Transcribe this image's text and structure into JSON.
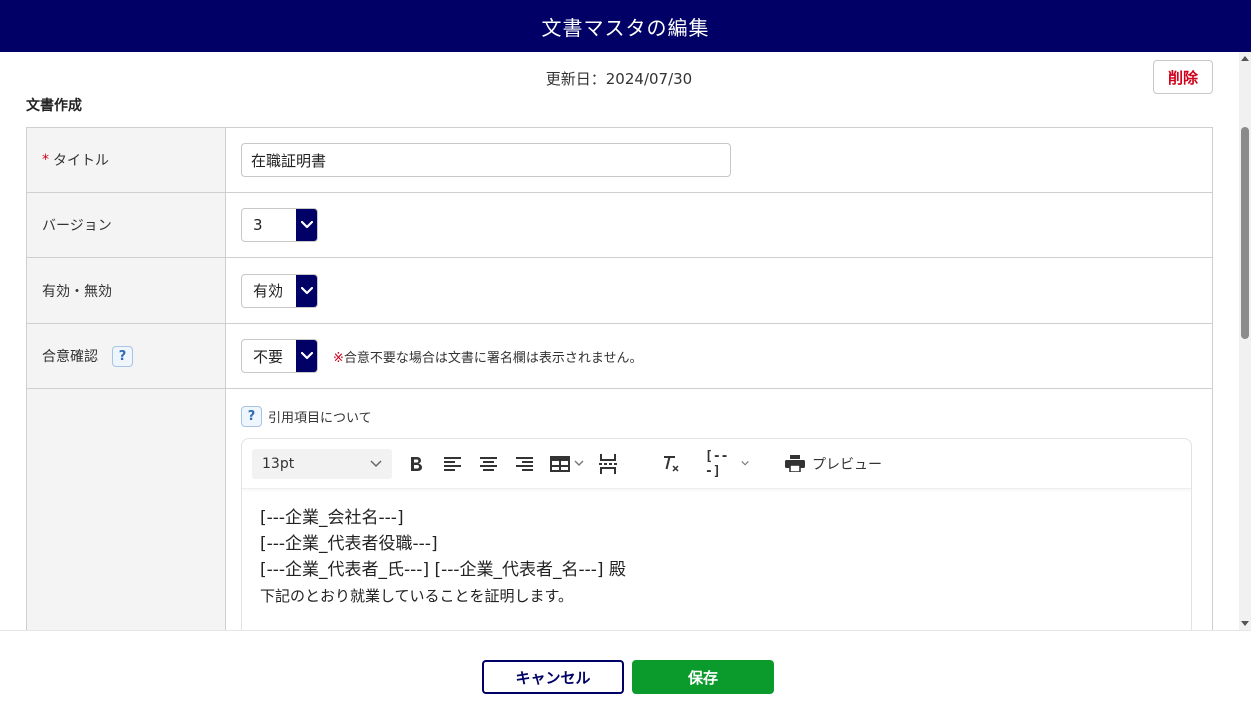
{
  "header": {
    "title": "文書マスタの編集"
  },
  "meta": {
    "updated": "更新日：2024/07/30",
    "delete_label": "削除"
  },
  "section": {
    "title": "文書作成"
  },
  "form": {
    "title": {
      "required_mark": "*",
      "label": "タイトル",
      "value": "在職証明書"
    },
    "version": {
      "label": "バージョン",
      "value": "3"
    },
    "status": {
      "label": "有効・無効",
      "value": "有効"
    },
    "consent": {
      "label": "合意確認",
      "value": "不要",
      "note_mark": "※",
      "note": "合意不要な場合は文書に署名欄は表示されません。"
    }
  },
  "editor": {
    "help_label": "引用項目について",
    "font_size": "13pt",
    "insert_label": "[---]",
    "preview_label": "プレビュー",
    "lines": [
      "[---企業_会社名---]",
      "[---企業_代表者役職---]",
      "[---企業_代表者_氏---] [---企業_代表者_名---] 殿",
      "下記のとおり就業していることを証明します。"
    ]
  },
  "footer": {
    "cancel_label": "キャンセル",
    "save_label": "保存"
  },
  "colors": {
    "header_bg": "#000066",
    "save_bg": "#0b9a2c",
    "delete_text": "#d0021b",
    "required": "#d0021b"
  },
  "icons": [
    "help-icon",
    "chevron-down-icon",
    "bold-icon",
    "align-left-icon",
    "align-center-icon",
    "align-right-icon",
    "table-icon",
    "page-break-icon",
    "clear-format-icon",
    "printer-icon"
  ]
}
